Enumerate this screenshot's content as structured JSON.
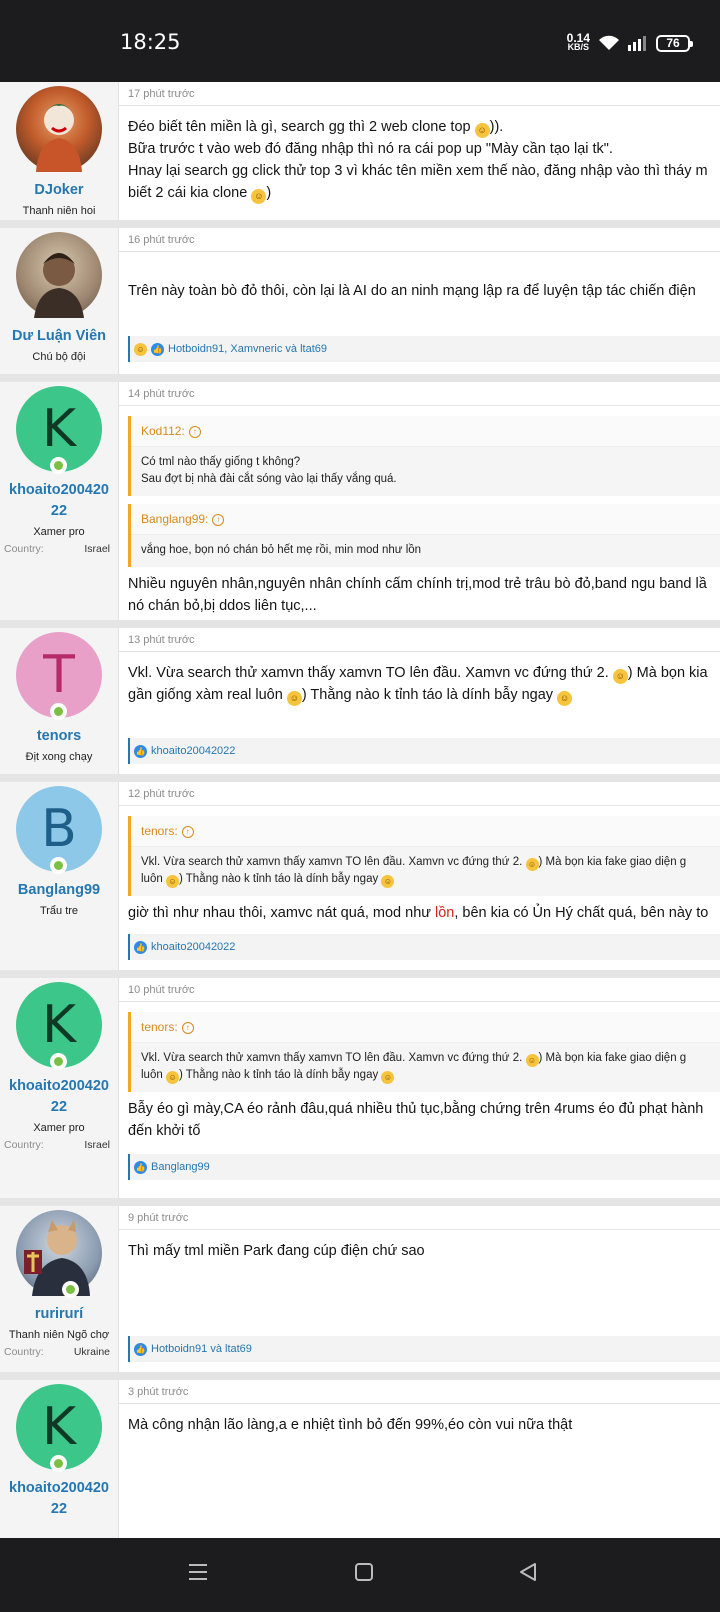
{
  "status": {
    "time": "18:25",
    "speed": "0.14",
    "speed_unit": "KB/S",
    "battery": "76"
  },
  "posts": [
    {
      "time": "17 phút trước",
      "user": {
        "name": "DJoker",
        "title": "Thanh niên hoi",
        "avatar": "photo-joker"
      },
      "lines": [
        "Đéo biết tên miền là gì, search gg thì 2 web clone top",
        "Bữa trước t vào web đó đăng nhập thì nó ra cái pop up \"Mày cần tạo lại tk\".",
        "Hnay lại search gg click thử top 3 vì khác tên miền xem thế nào, đăng nhập vào thì tháy m",
        "biết 2 cái kia clone"
      ],
      "line1_tail": ")).",
      "line4_tail": ")"
    },
    {
      "time": "16 phút trước",
      "user": {
        "name": "Dư Luận Viên",
        "title": "Chú bộ đội",
        "avatar": "photo-portrait"
      },
      "lines": [
        "Trên này toàn bò đỏ thôi, còn lại là AI do an ninh mạng lập ra để luyện tập tác chiến điện"
      ],
      "reactions": "Hotboidn91, Xamvneric và ltat69"
    },
    {
      "time": "14 phút trước",
      "user": {
        "name": "khoaito20042022",
        "name_l1": "khoaito200420",
        "name_l2": "22",
        "title": "Xamer pro",
        "letter": "K",
        "avatar_color": "#3cc68a",
        "country_label": "Country:",
        "country": "Israel"
      },
      "quotes": [
        {
          "author": "Kod112:",
          "lines": [
            "Có tml nào thấy giống t không?",
            "Sau đợt bị nhà đài cắt sóng vào lại thấy vắng quá."
          ]
        },
        {
          "author": "Banglang99:",
          "lines": [
            "vắng hoe, bọn nó chán bỏ hết mẹ rồi, min mod như lồn"
          ]
        }
      ],
      "lines": [
        "Nhiều nguyên nhân,nguyên nhân chính cấm chính trị,mod trẻ trâu bò đỏ,band ngu band lầ",
        "nó chán bỏ,bị ddos liên tục,..."
      ]
    },
    {
      "time": "13 phút trước",
      "user": {
        "name": "tenors",
        "title": "Địt xong chạy",
        "letter": "T",
        "avatar_color": "#e8a0c8",
        "letter_color": "#b62a6a"
      },
      "lines": [
        "Vkl. Vừa search thử xamvn thấy xamvn TO lên đầu. Xamvn vc đứng thứ 2.",
        "gần giống xàm real luôn"
      ],
      "line1_tail": ") Mà bọn kia",
      "line2_tail": ") Thằng nào k tỉnh táo là dính bẫy ngay",
      "reactions": "khoaito20042022"
    },
    {
      "time": "12 phút trước",
      "user": {
        "name": "Banglang99",
        "title": "Trẩu tre",
        "letter": "B",
        "avatar_color": "#8ec8e8",
        "letter_color": "#1e5f8a"
      },
      "quotes": [
        {
          "author": "tenors:",
          "lines": [
            "Vkl. Vừa search thử xamvn thấy xamvn TO lên đầu. Xamvn vc đứng thứ 2.",
            "luôn"
          ],
          "tail1": ") Mà bọn kia fake giao diện g",
          "tail2": ") Thằng nào k tỉnh táo là dính bẫy ngay"
        }
      ],
      "lines_pre": "giờ thì như nhau thôi, xamvc nát quá, mod như ",
      "lines_red": "lồn",
      "lines_post": ", bên kia có Ủn Hý chất quá, bên này to",
      "reactions": "khoaito20042022"
    },
    {
      "time": "10 phút trước",
      "user": {
        "name": "khoaito20042022",
        "name_l1": "khoaito200420",
        "name_l2": "22",
        "title": "Xamer pro",
        "letter": "K",
        "avatar_color": "#3cc68a",
        "country_label": "Country:",
        "country": "Israel"
      },
      "quotes": [
        {
          "author": "tenors:",
          "lines": [
            "Vkl. Vừa search thử xamvn thấy xamvn TO lên đầu. Xamvn vc đứng thứ 2.",
            "luôn"
          ],
          "tail1": ") Mà bọn kia fake giao diện g",
          "tail2": ") Thằng nào k tỉnh táo là dính bẫy ngay"
        }
      ],
      "lines": [
        "Bẫy éo gì mày,CA éo rảnh đâu,quá nhiều thủ tục,bằng chứng trên 4rums éo đủ phạt hành",
        "đến khởi tố"
      ],
      "reactions": "Banglang99"
    },
    {
      "time": "9 phút trước",
      "user": {
        "name": "rurirurí",
        "title": "Thanh niên Ngõ chợ",
        "avatar": "photo-cat-suit",
        "country_label": "Country:",
        "country": "Ukraine"
      },
      "lines": [
        "Thì mấy tml miền Park đang cúp điện chứ sao"
      ],
      "reactions": "Hotboidn91 và ltat69"
    },
    {
      "time": "3 phút trước",
      "user": {
        "name": "khoaito20042022",
        "name_l1": "khoaito200420",
        "name_l2": "22",
        "letter": "K",
        "avatar_color": "#3cc68a"
      },
      "lines": [
        "Mà công nhận lão làng,a e nhiệt tình bỏ đến 99%,éo còn vui nữa thật"
      ]
    }
  ]
}
